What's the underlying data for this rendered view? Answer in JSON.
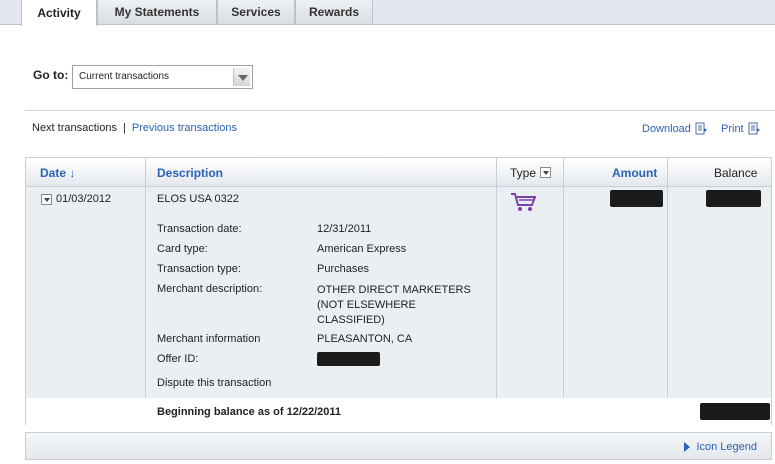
{
  "tabs": [
    {
      "label": "Activity"
    },
    {
      "label": "My Statements"
    },
    {
      "label": "Services"
    },
    {
      "label": "Rewards"
    }
  ],
  "goto": {
    "label": "Go to:",
    "selected": "Current transactions"
  },
  "nav": {
    "next": "Next transactions",
    "separator": "|",
    "previous": "Previous transactions",
    "download": "Download",
    "print": "Print"
  },
  "table": {
    "headers": {
      "date": "Date ↓",
      "description": "Description",
      "type": "Type",
      "amount": "Amount",
      "balance": "Balance"
    },
    "row": {
      "date": "01/03/2012",
      "merchant": "ELOS USA 0322",
      "details": [
        {
          "label": "Transaction date:",
          "value": "12/31/2011"
        },
        {
          "label": "Card type:",
          "value": "American Express"
        },
        {
          "label": "Transaction type:",
          "value": "Purchases"
        },
        {
          "label": "Merchant description:",
          "value": "OTHER DIRECT MARKETERS\n(NOT ELSEWHERE\nCLASSIFIED)"
        },
        {
          "label": "Merchant information",
          "value": "PLEASANTON, CA"
        },
        {
          "label": "Offer ID:",
          "value": ""
        }
      ],
      "dispute": "Dispute this transaction",
      "type_icon": "shopping-cart-icon"
    },
    "beginning_balance": "Beginning balance as of 12/22/2011"
  },
  "footer": {
    "legend": "Icon Legend"
  },
  "colors": {
    "link": "#2a62b8",
    "table_bg": "#eaeff4",
    "cart": "#7a3fb0"
  }
}
